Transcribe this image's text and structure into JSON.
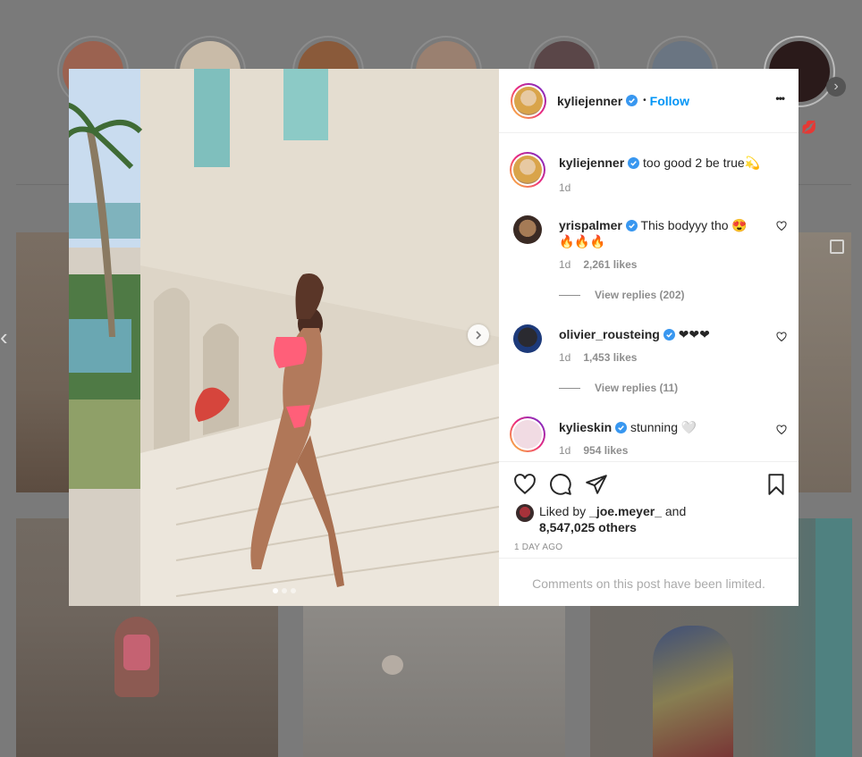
{
  "post": {
    "username": "kyliejenner",
    "follow_label": "Follow",
    "separator": "•",
    "more_label": "•••",
    "carousel_next": "›",
    "caption": "too good 2 be true💫",
    "caption_time": "1d"
  },
  "comments": [
    {
      "username": "yrispalmer",
      "text": "This bodyyy tho 😍🔥🔥🔥",
      "time": "1d",
      "likes": "2,261 likes",
      "replies": "View replies (202)"
    },
    {
      "username": "olivier_rousteing",
      "text": "❤❤❤",
      "time": "1d",
      "likes": "1,453 likes",
      "replies": "View replies (11)"
    },
    {
      "username": "kylieskin",
      "text": "stunning 🤍",
      "time": "1d",
      "likes": "954 likes"
    }
  ],
  "likes": {
    "prefix": "Liked by",
    "user": "_joe.meyer_",
    "conj": "and",
    "count": "8,547,025 others"
  },
  "timestamp": "1 DAY AGO",
  "comments_limited": "Comments on this post have been limited.",
  "background": {
    "story_last_label": "💋",
    "left_arrow": "‹"
  },
  "colors": {
    "link_blue": "#0095f6",
    "verified_blue": "#3897f0",
    "text": "#262626",
    "muted": "#8e8e8e"
  },
  "icons": [
    "heart-icon",
    "comment-icon",
    "share-icon",
    "bookmark-icon",
    "verified-icon",
    "more-icon",
    "chevron-right-icon"
  ]
}
